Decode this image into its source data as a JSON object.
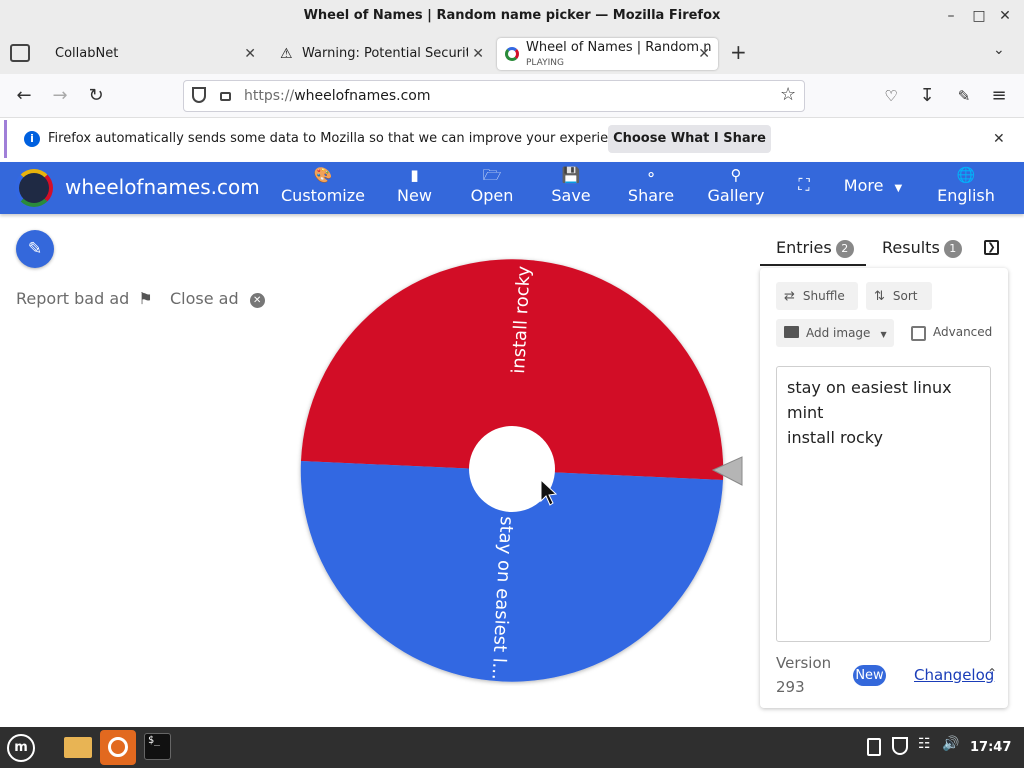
{
  "window": {
    "title": "Wheel of Names | Random name picker — Mozilla Firefox"
  },
  "tabs": [
    {
      "label": "CollabNet",
      "sub": ""
    },
    {
      "label": "Warning: Potential Security",
      "sub": ""
    },
    {
      "label": "Wheel of Names | Random n",
      "sub": "PLAYING"
    }
  ],
  "nav": {
    "url_scheme": "https://",
    "url_host": "wheelofnames.com"
  },
  "notification": {
    "text": "Firefox automatically sends some data to Mozilla so that we can improve your experience.",
    "button": "Choose What I Share"
  },
  "app": {
    "brand": "wheelofnames.com",
    "menu": [
      {
        "label": "Customize",
        "icon": "palette-icon"
      },
      {
        "label": "New",
        "icon": "file-icon"
      },
      {
        "label": "Open",
        "icon": "folder-open-icon"
      },
      {
        "label": "Save",
        "icon": "save-icon"
      },
      {
        "label": "Share",
        "icon": "share-icon"
      },
      {
        "label": "Gallery",
        "icon": "search-icon"
      },
      {
        "label": "",
        "icon": "fullscreen-icon"
      },
      {
        "label": "More",
        "icon": "chevron-down-icon"
      },
      {
        "label": "English",
        "icon": "globe-icon"
      }
    ]
  },
  "ads": {
    "report": "Report bad ad",
    "close": "Close ad"
  },
  "wheel": {
    "slices": [
      {
        "label": "install rocky",
        "color": "#d20f28"
      },
      {
        "label": "stay on easiest l...",
        "color": "#3368e2"
      }
    ]
  },
  "panel": {
    "entries_tab": "Entries",
    "entries_count": "2",
    "results_tab": "Results",
    "results_count": "1",
    "shuffle": "Shuffle",
    "sort": "Sort",
    "add_image": "Add image",
    "advanced": "Advanced",
    "entries": [
      "stay on easiest linux mint",
      "install rocky"
    ],
    "version_label": "Version",
    "version_number": "293",
    "new_badge": "New",
    "changelog": "Changelog"
  },
  "taskbar": {
    "clock": "17:47"
  },
  "colors": {
    "app_header": "#3468db",
    "accent": "#3468db"
  }
}
